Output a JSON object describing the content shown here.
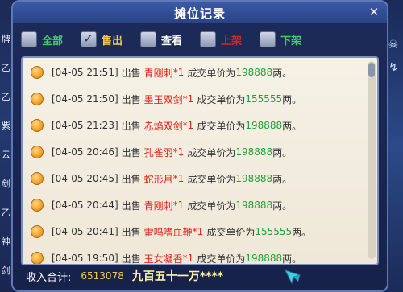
{
  "window": {
    "title": "摊位记录",
    "close_glyph": "✕"
  },
  "background": {
    "left_marks": [
      "牌",
      "乙",
      "乙",
      "紫",
      "云",
      "剑",
      "乙",
      "神",
      "剑"
    ],
    "right_marks": [
      "☠",
      "↯"
    ]
  },
  "filters": [
    {
      "label": "全部",
      "checked": false,
      "color": "#3ad06a"
    },
    {
      "label": "售出",
      "checked": true,
      "color": "#f2c94c"
    },
    {
      "label": "查看",
      "checked": false,
      "color": "#ffffff"
    },
    {
      "label": "上架",
      "checked": false,
      "color": "#e0231a"
    },
    {
      "label": "下架",
      "checked": false,
      "color": "#3ad06a"
    }
  ],
  "records": [
    {
      "time": "[04-05 21:51]",
      "action": "出售",
      "item": "青刚刺",
      "qty": "*1",
      "pre": "成交单价为",
      "price": "198888",
      "unit": "两。"
    },
    {
      "time": "[04-05 21:50]",
      "action": "出售",
      "item": "墨玉双剑",
      "qty": "*1",
      "pre": "成交单价为",
      "price": "155555",
      "unit": "两。"
    },
    {
      "time": "[04-05 21:23]",
      "action": "出售",
      "item": "赤焰双剑",
      "qty": "*1",
      "pre": "成交单价为",
      "price": "198888",
      "unit": "两。"
    },
    {
      "time": "[04-05 20:46]",
      "action": "出售",
      "item": "孔雀羽",
      "qty": "*1",
      "pre": "成交单价为",
      "price": "198888",
      "unit": "两。"
    },
    {
      "time": "[04-05 20:45]",
      "action": "出售",
      "item": "蛇形月",
      "qty": "*1",
      "pre": "成交单价为",
      "price": "198888",
      "unit": "两。"
    },
    {
      "time": "[04-05 20:44]",
      "action": "出售",
      "item": "青刚刺",
      "qty": "*1",
      "pre": "成交单价为",
      "price": "198888",
      "unit": "两。"
    },
    {
      "time": "[04-05 20:41]",
      "action": "出售",
      "item": "雷鸣嗜血鞭",
      "qty": "*1",
      "pre": "成交单价为",
      "price": "155555",
      "unit": "两。"
    },
    {
      "time": "[04-05 19:50]",
      "action": "出售",
      "item": "玉女凝香",
      "qty": "*1",
      "pre": "成交单价为",
      "price": "198888",
      "unit": "两。"
    }
  ],
  "footer": {
    "income_label": "收入合计:",
    "income_value": "6513078",
    "income_words": "九百五十一万****"
  }
}
